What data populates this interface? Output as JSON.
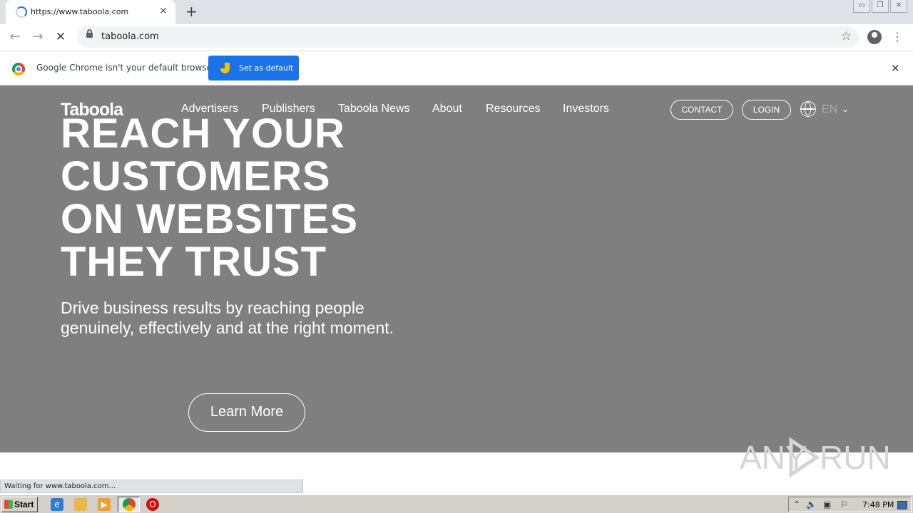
{
  "browser": {
    "tab": {
      "title": "https://www.taboola.com",
      "close": "✕"
    },
    "new_tab": "+",
    "window_buttons": {
      "minimize": "▭",
      "restore": "❐",
      "close": "✕"
    },
    "nav": {
      "back": "←",
      "forward": "→",
      "stop": "✕"
    },
    "address": "taboola.com",
    "bookmark_star": "☆",
    "menu": "⋮"
  },
  "infobar": {
    "message": "Google Chrome isn't your default browser",
    "button": "Set as default",
    "close": "✕"
  },
  "site": {
    "logo": "Taboola",
    "nav": [
      "Advertisers",
      "Publishers",
      "Taboola News",
      "About",
      "Resources",
      "Investors"
    ],
    "contact": "CONTACT",
    "login": "LOGIN",
    "language": "EN",
    "language_chevron": "⌄",
    "headline": [
      "REACH YOUR",
      "CUSTOMERS",
      "ON WEBSITES",
      "THEY TRUST"
    ],
    "subheadline": "Drive business results by reaching people genuinely, effectively and at the right moment.",
    "cta": "Learn More",
    "background_color": "#7f7f7f"
  },
  "status": "Waiting for www.taboola.com...",
  "watermark": {
    "left": "ANY",
    "right": "RUN"
  },
  "taskbar": {
    "start": "Start",
    "clock": "7:48 PM",
    "icons": [
      "ie-icon",
      "explorer-icon",
      "media-player-icon",
      "chrome-icon",
      "opera-icon"
    ]
  }
}
